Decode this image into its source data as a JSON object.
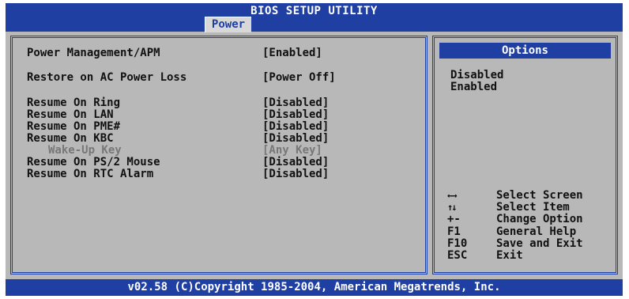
{
  "header": {
    "title": "BIOS SETUP UTILITY",
    "active_tab": "Power"
  },
  "footer": {
    "copyright": "v02.58 (C)Copyright 1985-2004, American Megatrends, Inc."
  },
  "settings": [
    {
      "label": "Power Management/APM",
      "value": "[Enabled]"
    },
    {
      "label": "Restore on AC Power Loss",
      "value": "[Power Off]"
    },
    {
      "label": "Resume On Ring",
      "value": "[Disabled]"
    },
    {
      "label": "Resume On LAN",
      "value": "[Disabled]"
    },
    {
      "label": "Resume On PME#",
      "value": "[Disabled]"
    },
    {
      "label": "Resume On KBC",
      "value": "[Disabled]"
    },
    {
      "label": "Wake-Up Key",
      "value": "[Any Key]"
    },
    {
      "label": "Resume On PS/2 Mouse",
      "value": "[Disabled]"
    },
    {
      "label": "Resume On RTC Alarm",
      "value": "[Disabled]"
    }
  ],
  "options_panel": {
    "title": "Options",
    "items": [
      "Disabled",
      "Enabled"
    ]
  },
  "help": [
    {
      "key": "←→",
      "desc": "Select Screen"
    },
    {
      "key": "↑↓",
      "desc": "Select Item"
    },
    {
      "key": "+-",
      "desc": "Change Option"
    },
    {
      "key": "F1",
      "desc": "General Help"
    },
    {
      "key": "F10",
      "desc": "Save and Exit"
    },
    {
      "key": "ESC",
      "desc": "Exit"
    }
  ]
}
